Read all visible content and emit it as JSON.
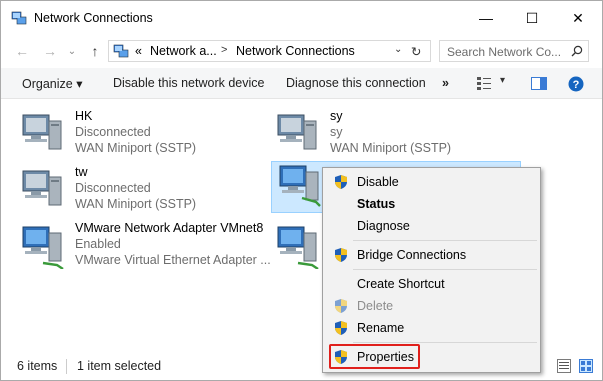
{
  "window": {
    "title": "Network Connections",
    "controls": {
      "minimize": "—",
      "maximize": "☐",
      "close": "✕"
    }
  },
  "address_bar": {
    "prefix": "«",
    "segment_1": "Network a...",
    "segment_2": "Network Connections",
    "separator": ">",
    "refresh": "↻",
    "search_placeholder": "Search Network Co..."
  },
  "command_bar": {
    "organize": "Organize ▾",
    "disable": "Disable this network device",
    "diagnose": "Diagnose this connection",
    "more": "»"
  },
  "connections": [
    {
      "name": "HK",
      "status": "Disconnected",
      "device": "WAN Miniport (SSTP)"
    },
    {
      "name": "sy",
      "status": "sy",
      "device": "WAN Miniport (SSTP)"
    },
    {
      "name": "tw",
      "status": "Disconnected",
      "device": "WAN Miniport (SSTP)"
    },
    {
      "name": "",
      "status": "",
      "device": ""
    },
    {
      "name": "VMware Network Adapter VMnet8",
      "status": "Enabled",
      "device": "VMware Virtual Ethernet Adapter ..."
    },
    {
      "name": "",
      "status": "",
      "device": ""
    }
  ],
  "context_menu": {
    "items": [
      {
        "label": "Disable",
        "shield": true
      },
      {
        "label": "Status",
        "bold": true
      },
      {
        "label": "Diagnose"
      },
      {
        "label": "Bridge Connections",
        "shield": true
      },
      {
        "label": "Create Shortcut"
      },
      {
        "label": "Delete",
        "shield": true,
        "disabled": true
      },
      {
        "label": "Rename",
        "shield": true
      },
      {
        "label": "Properties",
        "shield": true,
        "highlighted": true
      }
    ]
  },
  "status_bar": {
    "count": "6 items",
    "selection": "1 item selected"
  },
  "colors": {
    "accent": "#0078d7",
    "selection_bg": "#cce8ff",
    "highlight_border": "#e0201c"
  }
}
